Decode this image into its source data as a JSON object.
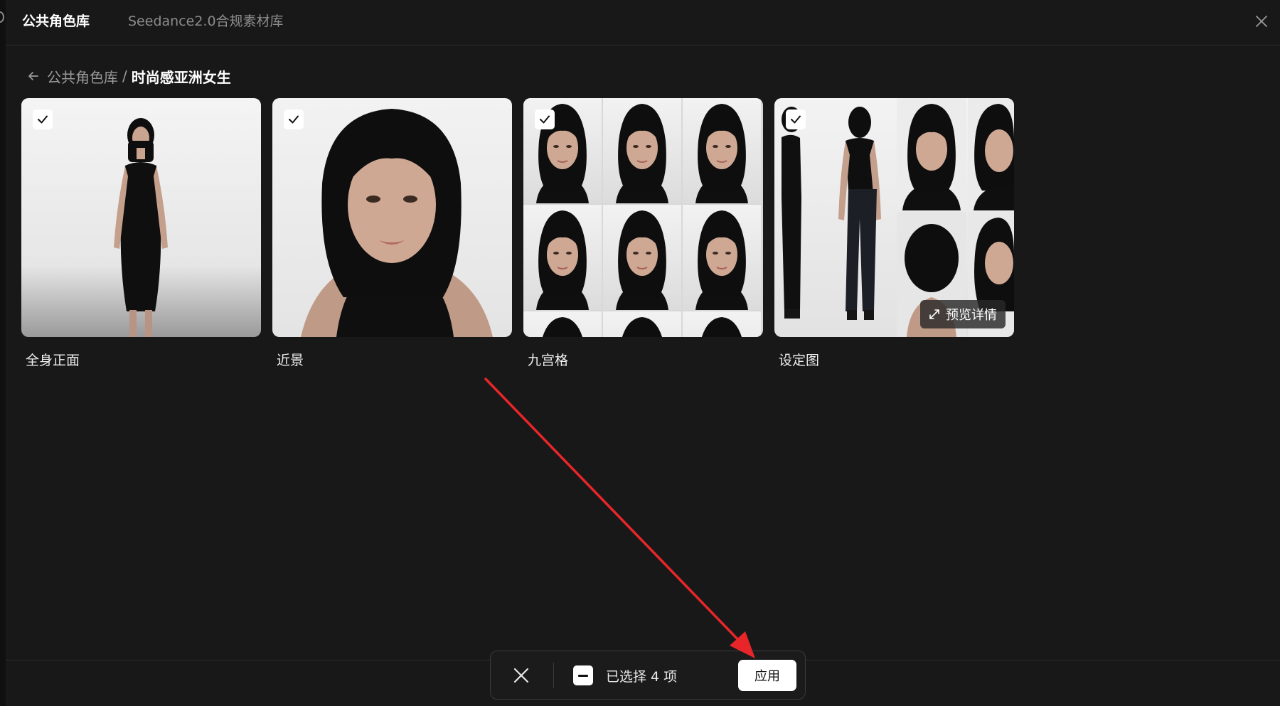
{
  "header": {
    "tabs": [
      {
        "label": "公共角色库",
        "active": true
      },
      {
        "label": "Seedance2.0合规素材库",
        "active": false
      }
    ],
    "close_icon": "close-icon"
  },
  "breadcrumb": {
    "parent": "公共角色库",
    "separator": "/",
    "current": "时尚感亚洲女生"
  },
  "cards": [
    {
      "label": "全身正面",
      "checked": true
    },
    {
      "label": "近景",
      "checked": true
    },
    {
      "label": "九宫格",
      "checked": true
    },
    {
      "label": "设定图",
      "checked": true,
      "preview_label": "预览详情"
    }
  ],
  "action_bar": {
    "count_text": "已选择 4 项",
    "apply_label": "应用"
  },
  "colors": {
    "background": "#181818",
    "annotation_arrow": "#e8262a",
    "accent": "#ffffff"
  }
}
